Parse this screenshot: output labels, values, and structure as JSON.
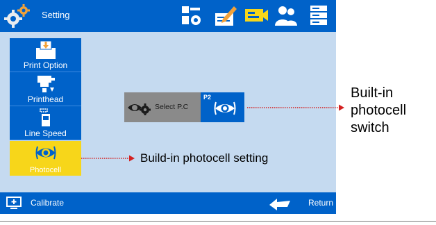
{
  "header": {
    "title": "Setting",
    "tabs": [
      {
        "icon": "system-settings-icon"
      },
      {
        "icon": "edit-message-icon"
      },
      {
        "icon": "photocell-camera-icon",
        "active": true
      },
      {
        "icon": "users-icon"
      },
      {
        "icon": "storage-icon"
      }
    ]
  },
  "sidebar": {
    "items": [
      {
        "label": "Print Option",
        "icon": "print-option-icon"
      },
      {
        "label": "Printhead",
        "icon": "printhead-icon"
      },
      {
        "label": "Line Speed",
        "icon": "line-speed-icon"
      },
      {
        "label": "Photocell",
        "icon": "photocell-icon",
        "active": true
      }
    ]
  },
  "main": {
    "select_label": "Select P.C",
    "p2_label": "P2"
  },
  "bottombar": {
    "calibrate_label": "Calibrate",
    "return_label": "Return"
  },
  "annotations": {
    "switch_lines": [
      "Built-in",
      "photocell",
      "switch"
    ],
    "setting_label": "Build-in photocell setting"
  },
  "colors": {
    "primary_blue": "#0062c9",
    "screen_bg": "#c5daf0",
    "active_yellow": "#f7d61a",
    "select_gray": "#8a8a8a",
    "annotation_red": "#d42020"
  }
}
